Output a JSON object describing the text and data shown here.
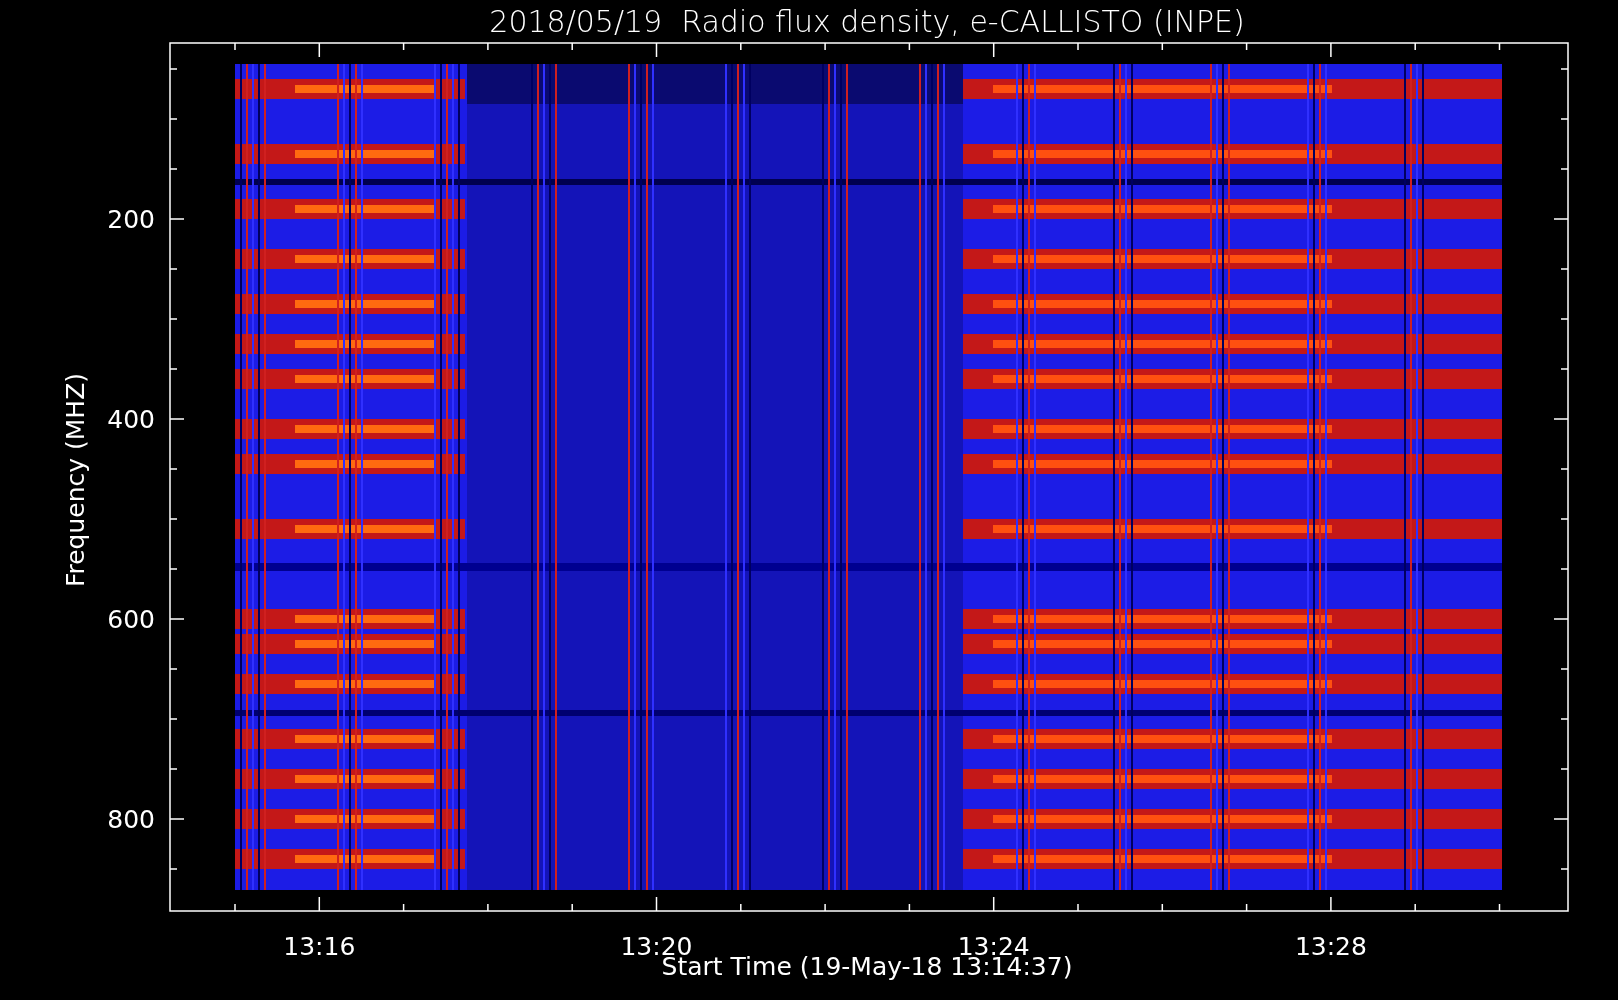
{
  "title": "2018/05/19  Radio flux density, e-CALLISTO (INPE)",
  "y_axis": {
    "label": "Frequency (MHZ)",
    "ticks": [
      "200",
      "400",
      "600",
      "800"
    ]
  },
  "x_axis": {
    "label": "Start Time (19-May-18 13:14:37)",
    "ticks": [
      "13:16",
      "13:20",
      "13:24",
      "13:28"
    ]
  }
}
